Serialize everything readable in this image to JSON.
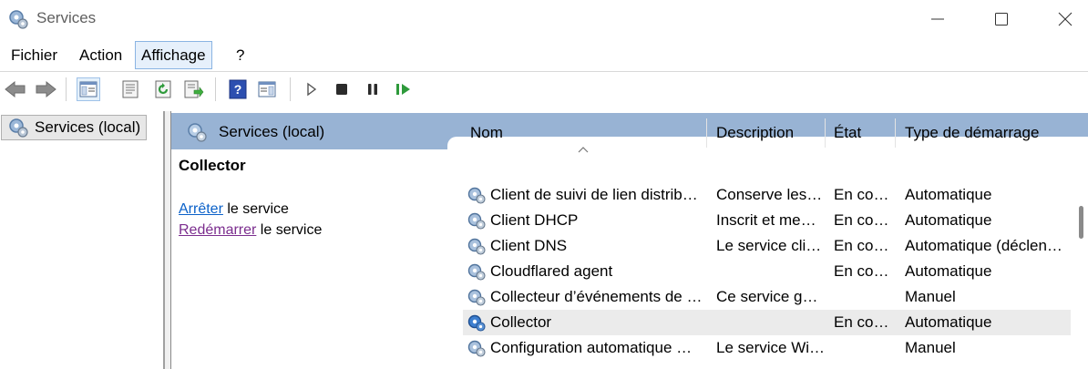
{
  "window": {
    "title": "Services",
    "controls": [
      "minimize-icon",
      "maximize-icon",
      "close-icon"
    ]
  },
  "menu": {
    "items": [
      "Fichier",
      "Action",
      "Affichage",
      "?"
    ],
    "active": "Affichage"
  },
  "toolbar": {
    "icons": [
      "back-arrow-icon",
      "forward-arrow-icon",
      "show-hide-tree-icon",
      "properties-icon",
      "refresh-icon",
      "export-list-icon",
      "help-icon",
      "action-pane-icon",
      "start-service-icon",
      "stop-service-icon",
      "pause-service-icon",
      "restart-service-icon"
    ]
  },
  "tree": {
    "item": "Services (local)"
  },
  "panel": {
    "header": "Services (local)",
    "selected_service": "Collector",
    "stop_link": "Arrêter",
    "stop_suffix": " le service",
    "restart_link": "Redémarrer",
    "restart_suffix": " le service"
  },
  "table": {
    "columns": [
      "Nom",
      "Description",
      "État",
      "Type de démarrage"
    ],
    "rows": [
      {
        "name": "Client de suivi de lien distrib…",
        "description": "Conserve les…",
        "state": "En co…",
        "startup": "Automatique"
      },
      {
        "name": "Client DHCP",
        "description": "Inscrit et me…",
        "state": "En co…",
        "startup": "Automatique"
      },
      {
        "name": "Client DNS",
        "description": "Le service cli…",
        "state": "En co…",
        "startup": "Automatique (déclen…"
      },
      {
        "name": "Cloudflared agent",
        "description": "",
        "state": "En co…",
        "startup": "Automatique"
      },
      {
        "name": "Collecteur d’événements de …",
        "description": "Ce service g…",
        "state": "",
        "startup": "Manuel"
      },
      {
        "name": "Collector",
        "description": "",
        "state": "En co…",
        "startup": "Automatique"
      },
      {
        "name": "Configuration automatique …",
        "description": "Le service Wi…",
        "state": "",
        "startup": "Manuel"
      }
    ],
    "selected_index": 5
  },
  "colors": {
    "header_bar": "#98b3d4",
    "link": "#0b61c9",
    "visited_link": "#7b2d8e",
    "selected_row": "#ebebeb"
  }
}
